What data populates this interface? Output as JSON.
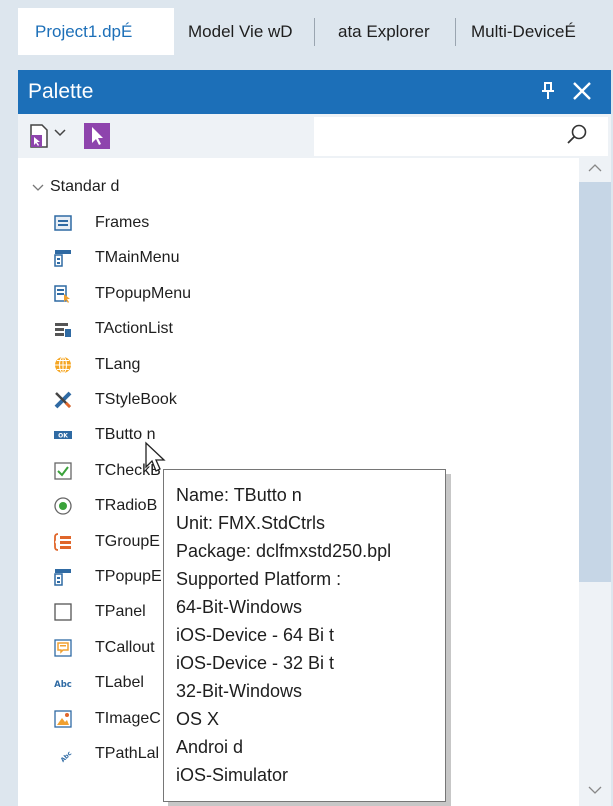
{
  "tabs": [
    {
      "label": "Project1.dpÉ",
      "active": true
    },
    {
      "label": "Model Vie  wD",
      "active": false
    },
    {
      "label": "ata Explorer",
      "active": false
    },
    {
      "label": "Multi-DeviceÉ",
      "active": false
    }
  ],
  "palette": {
    "title": "Palette",
    "search": {
      "placeholder": "",
      "value": ""
    },
    "group": "Standar  d",
    "items": [
      {
        "label": "Frames",
        "icon": "frames-icon"
      },
      {
        "label": "TMainMenu",
        "icon": "main-menu-icon"
      },
      {
        "label": "TPopupMenu",
        "icon": "popup-menu-icon"
      },
      {
        "label": "TActionList",
        "icon": "action-list-icon"
      },
      {
        "label": "TLang",
        "icon": "globe-icon"
      },
      {
        "label": "TStyleBook",
        "icon": "style-book-icon"
      },
      {
        "label": "TButto  n",
        "icon": "ok-button-icon"
      },
      {
        "label": "TCheckB",
        "icon": "checkbox-icon"
      },
      {
        "label": "TRadioB",
        "icon": "radio-button-icon"
      },
      {
        "label": "TGroupE",
        "icon": "group-box-icon"
      },
      {
        "label": "TPopupE",
        "icon": "popup-box-icon"
      },
      {
        "label": "TPanel",
        "icon": "panel-icon"
      },
      {
        "label": "TCallout",
        "icon": "callout-icon"
      },
      {
        "label": "TLabel",
        "icon": "label-icon"
      },
      {
        "label": "TImageC",
        "icon": "image-control-icon"
      },
      {
        "label": "TPathLal",
        "icon": "path-label-icon"
      }
    ]
  },
  "tooltip": {
    "lines": [
      "Name: TButto    n",
      "Unit: FMX.StdCtrls",
      "Package: dclfmxstd250.bpl",
      "Supported Platform     :",
      "64-Bit-Windows",
      "iOS-Device - 64 Bi    t",
      "iOS-Device - 32 Bi    t",
      "32-Bit-Windows",
      "OS X",
      "Androi d",
      "iOS-Simulator"
    ]
  },
  "colors": {
    "accent": "#1c6fb8",
    "panel_bg": "#dde6ee",
    "pointer_purple": "#8e44ad"
  }
}
